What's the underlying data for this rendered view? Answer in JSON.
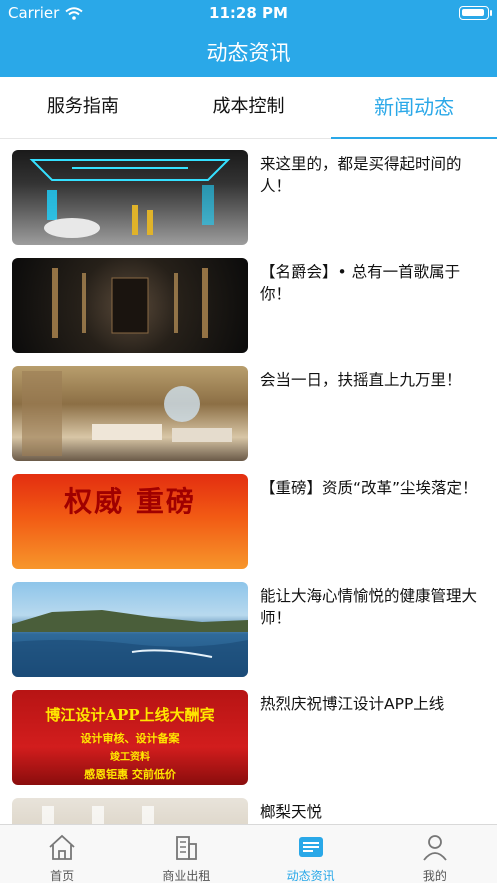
{
  "status_bar": {
    "carrier": "Carrier",
    "time": "11:28 PM"
  },
  "nav": {
    "title": "动态资讯"
  },
  "tabs": [
    {
      "label": "服务指南"
    },
    {
      "label": "成本控制"
    },
    {
      "label": "新闻动态"
    }
  ],
  "news": [
    {
      "title": "来这里的，都是买得起时间的人！"
    },
    {
      "title": "【名爵会】• 总有一首歌属于你！"
    },
    {
      "title": "会当一日，扶摇直上九万里！"
    },
    {
      "title": "【重磅】资质“改革”尘埃落定！",
      "banner": "权威  重磅"
    },
    {
      "title": "能让大海心情愉悦的健康管理大师！"
    },
    {
      "title": "热烈庆祝博江设计APP上线",
      "banner": "博江设计APP上线大酬宾",
      "banner_sub": "设计审核、设计备案",
      "banner_sub2": "竣工资料",
      "banner_sub3": "感恩钜惠  交前低价"
    },
    {
      "title": "榔梨天悦"
    }
  ],
  "tabbar": [
    {
      "label": "首页",
      "icon": "home-icon"
    },
    {
      "label": "商业出租",
      "icon": "building-icon"
    },
    {
      "label": "动态资讯",
      "icon": "news-icon"
    },
    {
      "label": "我的",
      "icon": "user-icon"
    }
  ],
  "colors": {
    "accent": "#2aa8e8"
  }
}
